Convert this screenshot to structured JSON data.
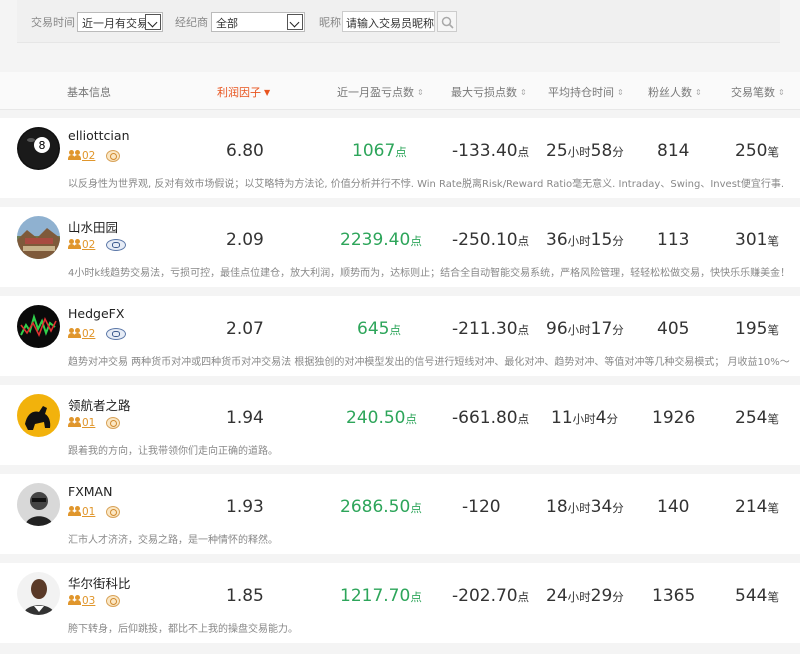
{
  "filter": {
    "time_label": "交易时间",
    "time_value": "近一月有交易",
    "broker_label": "经纪商",
    "broker_value": "全部",
    "nick_label": "昵称",
    "nick_value": "请输入交易员昵称"
  },
  "header": {
    "basic": "基本信息",
    "profit_factor": "利润因子",
    "month_points": "近一月盈亏点数",
    "max_loss": "最大亏损点数",
    "avg_hold": "平均持仓时间",
    "fans": "粉丝人数",
    "trades": "交易笔数"
  },
  "units": {
    "points": "点",
    "hours": "小时",
    "minutes": "分",
    "trades": "笔"
  },
  "traders": [
    {
      "name": "elliottcian",
      "level": "02",
      "broker": "gold",
      "factor": "6.80",
      "month": "1067",
      "loss": "-133.40",
      "hours": "25",
      "mins": "58",
      "fans": "814",
      "trades": "250",
      "desc": "以反身性为世界观, 反对有效市场假说；以艾略特为方法论, 价值分析并行不悖. Win Rate脱离Risk/Reward Ratio毫无意义. Intraday、Swing、Invest便宜行事."
    },
    {
      "name": "山水田园",
      "level": "02",
      "broker": "fx",
      "factor": "2.09",
      "month": "2239.40",
      "loss": "-250.10",
      "hours": "36",
      "mins": "15",
      "fans": "113",
      "trades": "301",
      "desc": "4小时k线趋势交易法，亏损可控，最佳点位建仓，放大利润，顺势而为，达标则止；结合全自动智能交易系统，严格风险管理，轻轻松松做交易，快快乐乐赚美金！"
    },
    {
      "name": "HedgeFX",
      "level": "02",
      "broker": "fx",
      "factor": "2.07",
      "month": "645",
      "loss": "-211.30",
      "hours": "96",
      "mins": "17",
      "fans": "405",
      "trades": "195",
      "desc": "趋势对冲交易 两种货币对冲或四种货币对冲交易法 根据独创的对冲模型发出的信号进行短线对冲、最化对冲、趋势对冲、等值对冲等几种交易模式； 月收益10%～"
    },
    {
      "name": "领航者之路",
      "level": "01",
      "broker": "gold",
      "factor": "1.94",
      "month": "240.50",
      "loss": "-661.80",
      "hours": "11",
      "mins": "4",
      "fans": "1926",
      "trades": "254",
      "desc": "跟着我的方向，让我带领你们走向正确的道路。"
    },
    {
      "name": "FXMAN",
      "level": "01",
      "broker": "gold",
      "factor": "1.93",
      "month": "2686.50",
      "loss": "-120",
      "hours": "18",
      "mins": "34",
      "fans": "140",
      "trades": "214",
      "desc": "汇市人才济济，交易之路，是一种情怀的释然。"
    },
    {
      "name": "华尔街科比",
      "level": "03",
      "broker": "gold",
      "factor": "1.85",
      "month": "1217.70",
      "loss": "-202.70",
      "hours": "24",
      "mins": "29",
      "fans": "1365",
      "trades": "544",
      "desc": "胯下转身，后仰跳投，都比不上我的操盘交易能力。"
    }
  ],
  "colors": {
    "accent": "#e8541e",
    "profit": "#2da55a"
  }
}
